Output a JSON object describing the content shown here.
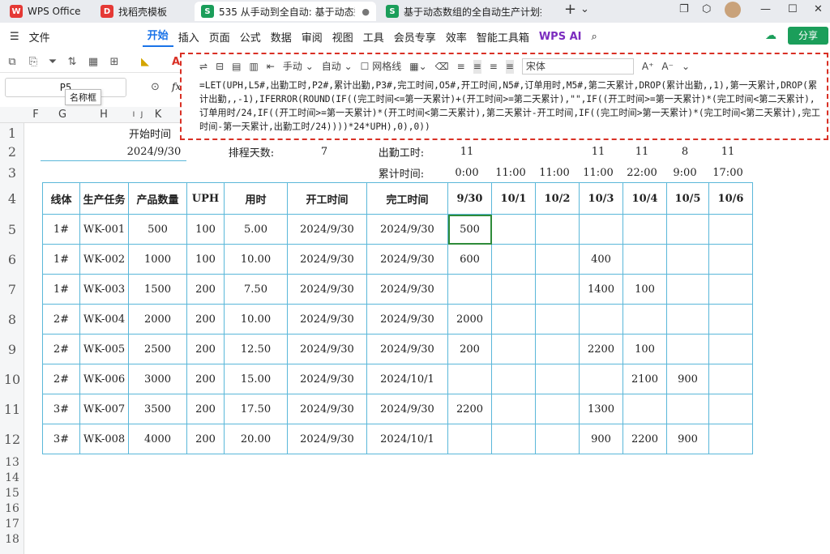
{
  "tabs": [
    {
      "label": "WPS Office",
      "icon": "wps-logo-icon",
      "color": "#e53935"
    },
    {
      "label": "找稻壳模板",
      "icon": "docer-icon",
      "color": "#e53935"
    },
    {
      "label": "535 从手动到全自动: 基于动态数",
      "icon": "sheet-icon",
      "color": "#1b9e5a"
    },
    {
      "label": "基于动态数组的全自动生产计划排",
      "icon": "sheet-icon",
      "color": "#1b9e5a"
    }
  ],
  "menu": {
    "file": "文件",
    "items": [
      "开始",
      "插入",
      "页面",
      "公式",
      "数据",
      "审阅",
      "视图",
      "工具",
      "会员专享",
      "效率",
      "智能工具箱"
    ],
    "wps_ai": "WPS AI",
    "share": "分享"
  },
  "toolbar": {
    "manual": "手动",
    "auto": "自动",
    "gridlines": "网格线",
    "font": "宋体"
  },
  "namebox": {
    "value": "P5",
    "tooltip": "名称框"
  },
  "formula": "=LET(UPH,L5#,出勤工时,P2#,累计出勤,P3#,完工时间,O5#,开工时间,N5#,订单用时,M5#,第二天累计,DROP(累计出勤,,1),第一天累计,DROP(累计出勤,,-1),IFERROR(ROUND(IF((完工时间<=第一天累计)+(开工时间>=第二天累计),\"\",IF((开工时间>=第一天累计)*(完工时间<第二天累计),订单用时/24,IF((开工时间>=第一天累计)*(开工时间<第二天累计),第二天累计-开工时间,IF((完工时间>第一天累计)*(完工时间<第二天累计),完工时间-第一天累计,出勤工时/24))))*24*UPH),0),0))",
  "columns": [
    "F",
    "G",
    "H",
    "I",
    "J",
    "K"
  ],
  "rows": [
    "1",
    "2",
    "3",
    "4",
    "5",
    "6",
    "7",
    "8",
    "9",
    "10",
    "11",
    "12",
    "13",
    "14",
    "15",
    "16",
    "17",
    "18"
  ],
  "sheet": {
    "start_label": "开始时间",
    "start_date": "2024/9/30",
    "days_label": "排程天数:",
    "days_value": "7",
    "hours_label": "出勤工时:",
    "hours": [
      "11",
      "",
      "",
      "11",
      "11",
      "8",
      "11"
    ],
    "cum_label": "累计时间:",
    "cum": [
      "0:00",
      "11:00",
      "11:00",
      "11:00",
      "22:00",
      "9:00",
      "17:00"
    ],
    "headers": [
      "线体",
      "生产任务",
      "产品数量",
      "UPH",
      "用时",
      "开工时间",
      "完工时间",
      "9/30",
      "10/1",
      "10/2",
      "10/3",
      "10/4",
      "10/5",
      "10/6"
    ],
    "table_rows": [
      [
        "1#",
        "WK-001",
        "500",
        "100",
        "5.00",
        "2024/9/30",
        "2024/9/30",
        "500",
        "",
        "",
        "",
        "",
        "",
        ""
      ],
      [
        "1#",
        "WK-002",
        "1000",
        "100",
        "10.00",
        "2024/9/30",
        "2024/9/30",
        "600",
        "",
        "",
        "400",
        "",
        "",
        ""
      ],
      [
        "1#",
        "WK-003",
        "1500",
        "200",
        "7.50",
        "2024/9/30",
        "2024/9/30",
        "",
        "",
        "",
        "1400",
        "100",
        "",
        ""
      ],
      [
        "2#",
        "WK-004",
        "2000",
        "200",
        "10.00",
        "2024/9/30",
        "2024/9/30",
        "2000",
        "",
        "",
        "",
        "",
        "",
        ""
      ],
      [
        "2#",
        "WK-005",
        "2500",
        "200",
        "12.50",
        "2024/9/30",
        "2024/9/30",
        "200",
        "",
        "",
        "2200",
        "100",
        "",
        ""
      ],
      [
        "2#",
        "WK-006",
        "3000",
        "200",
        "15.00",
        "2024/9/30",
        "2024/10/1",
        "",
        "",
        "",
        "",
        "2100",
        "900",
        ""
      ],
      [
        "3#",
        "WK-007",
        "3500",
        "200",
        "17.50",
        "2024/9/30",
        "2024/9/30",
        "2200",
        "",
        "",
        "1300",
        "",
        "",
        ""
      ],
      [
        "3#",
        "WK-008",
        "4000",
        "200",
        "20.00",
        "2024/9/30",
        "2024/10/1",
        "",
        "",
        "",
        "900",
        "2200",
        "900",
        ""
      ]
    ]
  },
  "colors": {
    "accent": "#1a73e8",
    "border_highlight": "#d93025",
    "table_border": "#5ab7d9",
    "share": "#1b9e5a"
  }
}
